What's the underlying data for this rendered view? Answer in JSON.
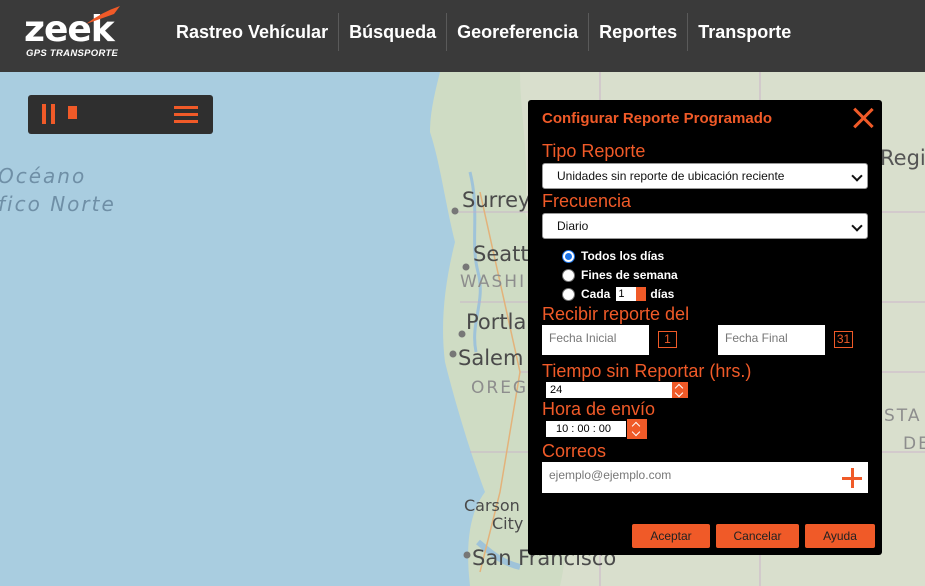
{
  "brand": {
    "logo_word": "zeek",
    "logo_sub": "GPS TRANSPORTE",
    "accent": "#f05a28"
  },
  "nav": [
    {
      "label": "Rastreo Vehícular"
    },
    {
      "label": "Búsqueda"
    },
    {
      "label": "Georeferencia"
    },
    {
      "label": "Reportes"
    },
    {
      "label": "Transporte"
    }
  ],
  "map": {
    "ocean_line1": "Océano",
    "ocean_line2": "fico Norte",
    "cities": [
      "Surrey",
      "Seatt",
      "WASHI",
      "Portla",
      "Salem",
      "OREGO",
      "Carson",
      "City",
      "San Francisco",
      "Regi",
      "STA",
      "DE"
    ]
  },
  "dialog": {
    "title": "Configurar Reporte Programado",
    "tipo_label": "Tipo Reporte",
    "tipo_value": "Unidades sin reporte de ubicación reciente",
    "frecuencia_label": "Frecuencia",
    "frecuencia_value": "Diario",
    "opt_todos": "Todos los días",
    "opt_fines": "Fines de semana",
    "opt_cada": "Cada",
    "cada_value": "1",
    "cada_unit": "días",
    "recibir_label": "Recibir reporte del",
    "fecha_inicial_placeholder": "Fecha Inicial",
    "fecha_final_placeholder": "Fecha Final",
    "cal_start_num": "1",
    "cal_end_num": "31",
    "tiempo_label": "Tiempo sin Reportar (hrs.)",
    "tiempo_value": "24",
    "hora_label": "Hora de envío",
    "hora_value": "10 : 00 : 00",
    "correos_label": "Correos",
    "correos_placeholder": "ejemplo@ejemplo.com",
    "btn_aceptar": "Aceptar",
    "btn_cancelar": "Cancelar",
    "btn_ayuda": "Ayuda"
  }
}
